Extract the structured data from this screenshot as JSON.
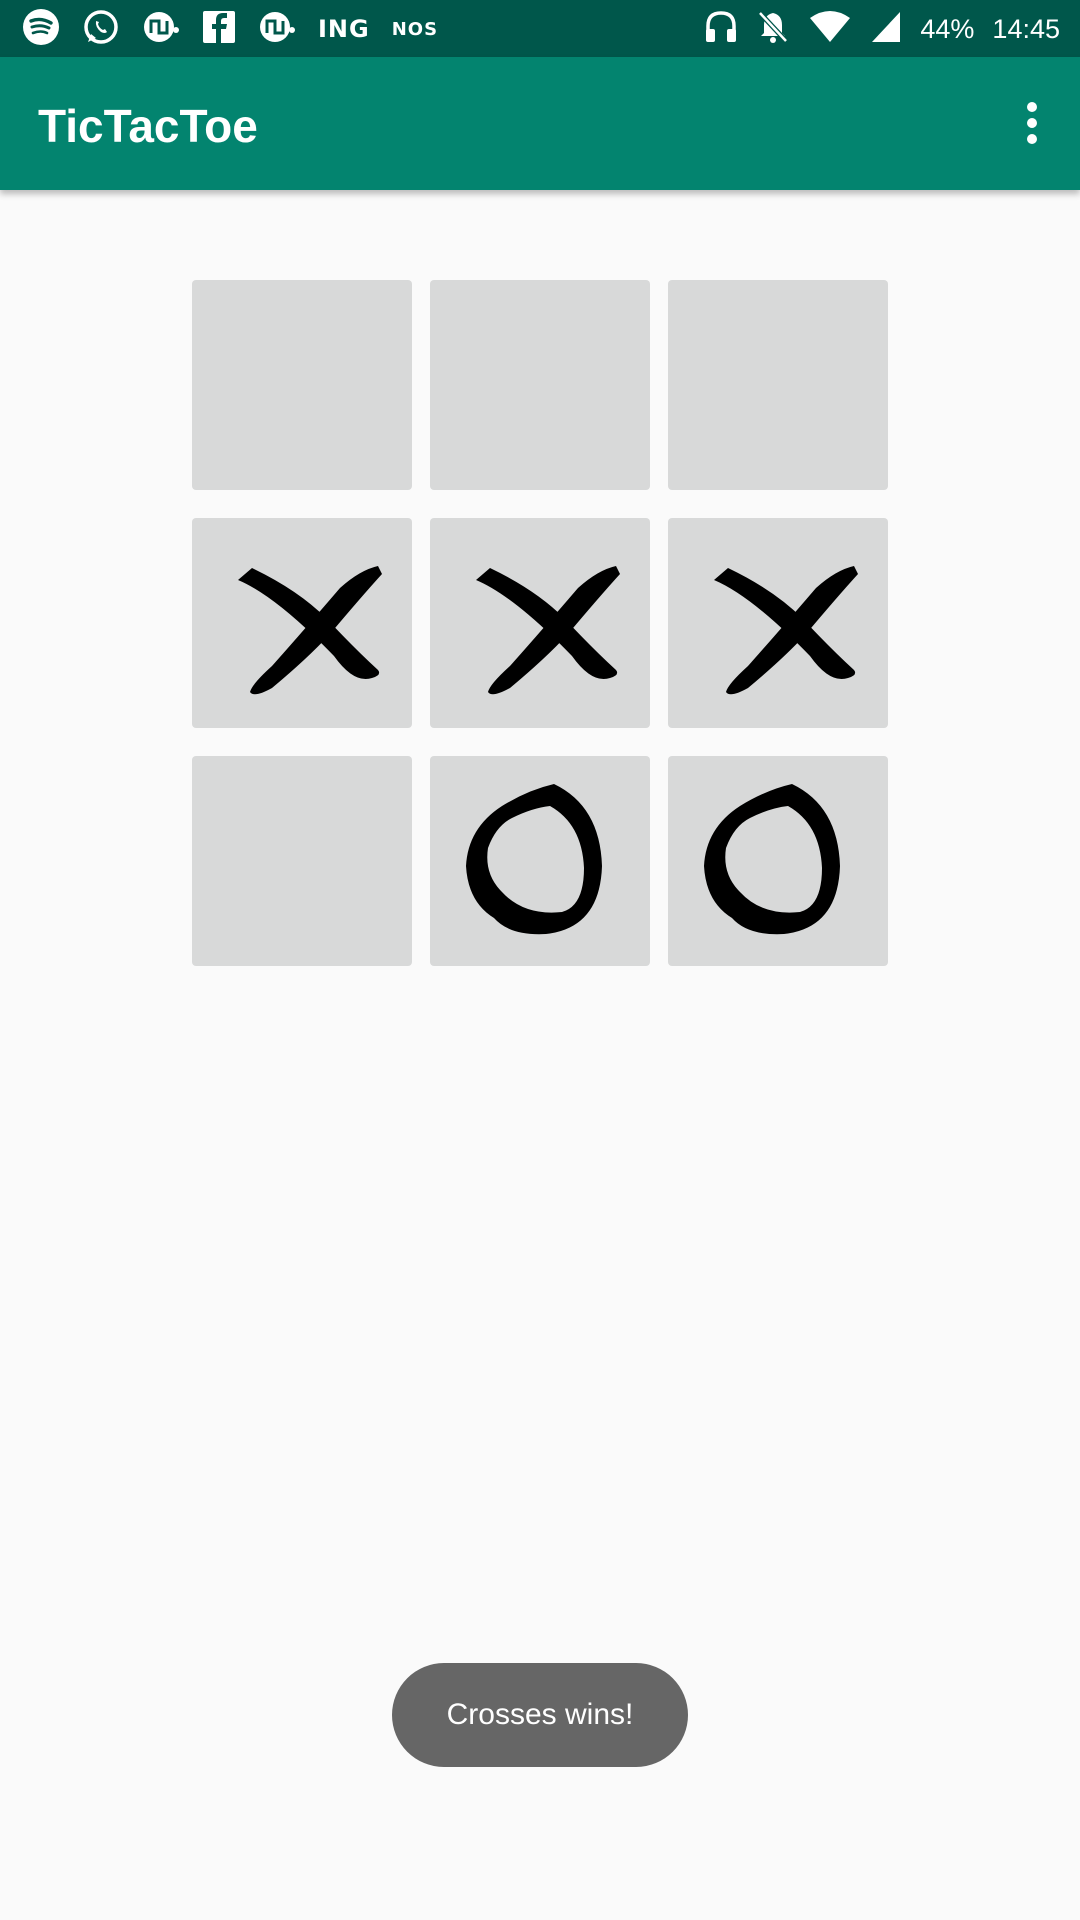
{
  "status_bar": {
    "left_icons": [
      "spotify-icon",
      "whatsapp-icon",
      "nu-icon",
      "facebook-icon",
      "nu-icon"
    ],
    "ing_label": "ING",
    "nos_label": "NOS",
    "right_icons": [
      "headphones-icon",
      "bell-off-icon",
      "wifi-icon",
      "cell-signal-icon"
    ],
    "battery": "44%",
    "time": "14:45",
    "background_color": "#00574b"
  },
  "app_bar": {
    "title": "TicTacToe",
    "background_color": "#03846f",
    "overflow_icon": "more-vert-icon"
  },
  "board": {
    "cells": [
      "",
      "",
      "",
      "X",
      "X",
      "X",
      "",
      "O",
      "O"
    ],
    "cell_color": "#d8d9d9"
  },
  "toast": {
    "message": "Crosses wins!",
    "background_color": "#666666"
  }
}
